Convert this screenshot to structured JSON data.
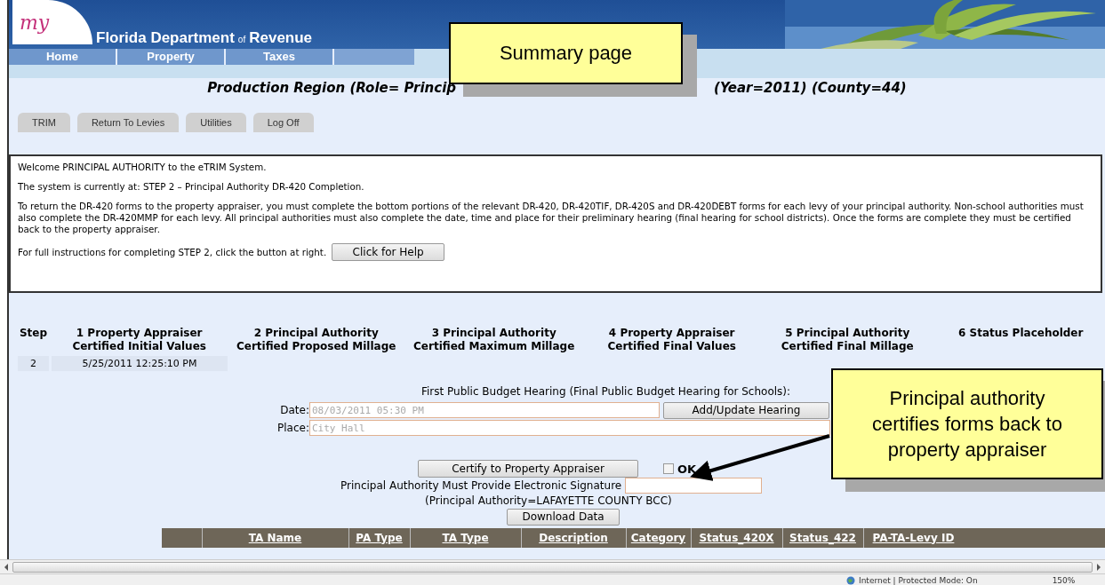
{
  "header": {
    "logo_text": "my",
    "title": "Florida Department",
    "title_small": "of",
    "title_end": "Revenue"
  },
  "nav": [
    "Home",
    "Property",
    "Taxes"
  ],
  "region_title_left": "Production Region (Role= Princip",
  "region_title_right": "(Year=2011) (County=44)",
  "toolbar_tabs": [
    "TRIM",
    "Return To Levies",
    "Utilities",
    "Log Off"
  ],
  "welcome": {
    "lines": [
      "Welcome PRINCIPAL AUTHORITY to the eTRIM System.",
      "The system is currently at: STEP 2 – Principal Authority DR-420 Completion.",
      "To return the DR-420 forms to the property appraiser, you must complete the bottom portions of the relevant DR-420, DR-420TIF, DR-420S and DR-420DEBT forms for each levy of your principal authority. Non-school authorities must also complete the DR-420MMP for each levy. All principal authorities must also complete the date, time and place for their preliminary hearing (final hearing for school districts). Once the forms are complete they must be certified back to the property appraiser."
    ],
    "help_text": "For full instructions for completing STEP 2, click the button at right.",
    "help_button": "Click for Help"
  },
  "steps": {
    "columns": [
      "Step",
      "1 Property Appraiser Certified Initial Values",
      "2 Principal Authority Certified Proposed Millage",
      "3 Principal Authority Certified Maximum Millage",
      "4 Property Appraiser Certified Final Values",
      "5 Principal Authority Certified Final Millage",
      "6 Status Placeholder"
    ],
    "rows": [
      [
        "2",
        "5/25/2011 12:25:10 PM"
      ]
    ]
  },
  "hearing": {
    "title": "First Public Budget Hearing (Final Public Budget Hearing for Schools):",
    "fields": [
      {
        "label": "Date:",
        "value": "08/03/2011 05:30 PM",
        "disabled": true,
        "kind": "with-button",
        "button": "Add/Update Hearing"
      },
      {
        "label": "Place:",
        "value": "City Hall",
        "disabled": true,
        "kind": "wide"
      }
    ]
  },
  "certify": {
    "button": "Certify to Property Appraiser",
    "ok_label": "OK",
    "checked": false,
    "signature_label": "Principal Authority Must Provide Electronic Signature",
    "authority": "(Principal Authority=LAFAYETTE COUNTY BCC)",
    "download_button": "Download Data"
  },
  "levy_table": {
    "columns": [
      "TA Name",
      "PA Type",
      "TA Type",
      "Description",
      "Category",
      "Status_420X",
      "Status_422",
      "PA-TA-Levy ID"
    ]
  },
  "status_bar": {
    "zone": "Internet | Protected Mode: On",
    "zoom": "150%"
  },
  "callouts": [
    "Summary page",
    "Principal authority certifies forms back to property appraiser"
  ]
}
